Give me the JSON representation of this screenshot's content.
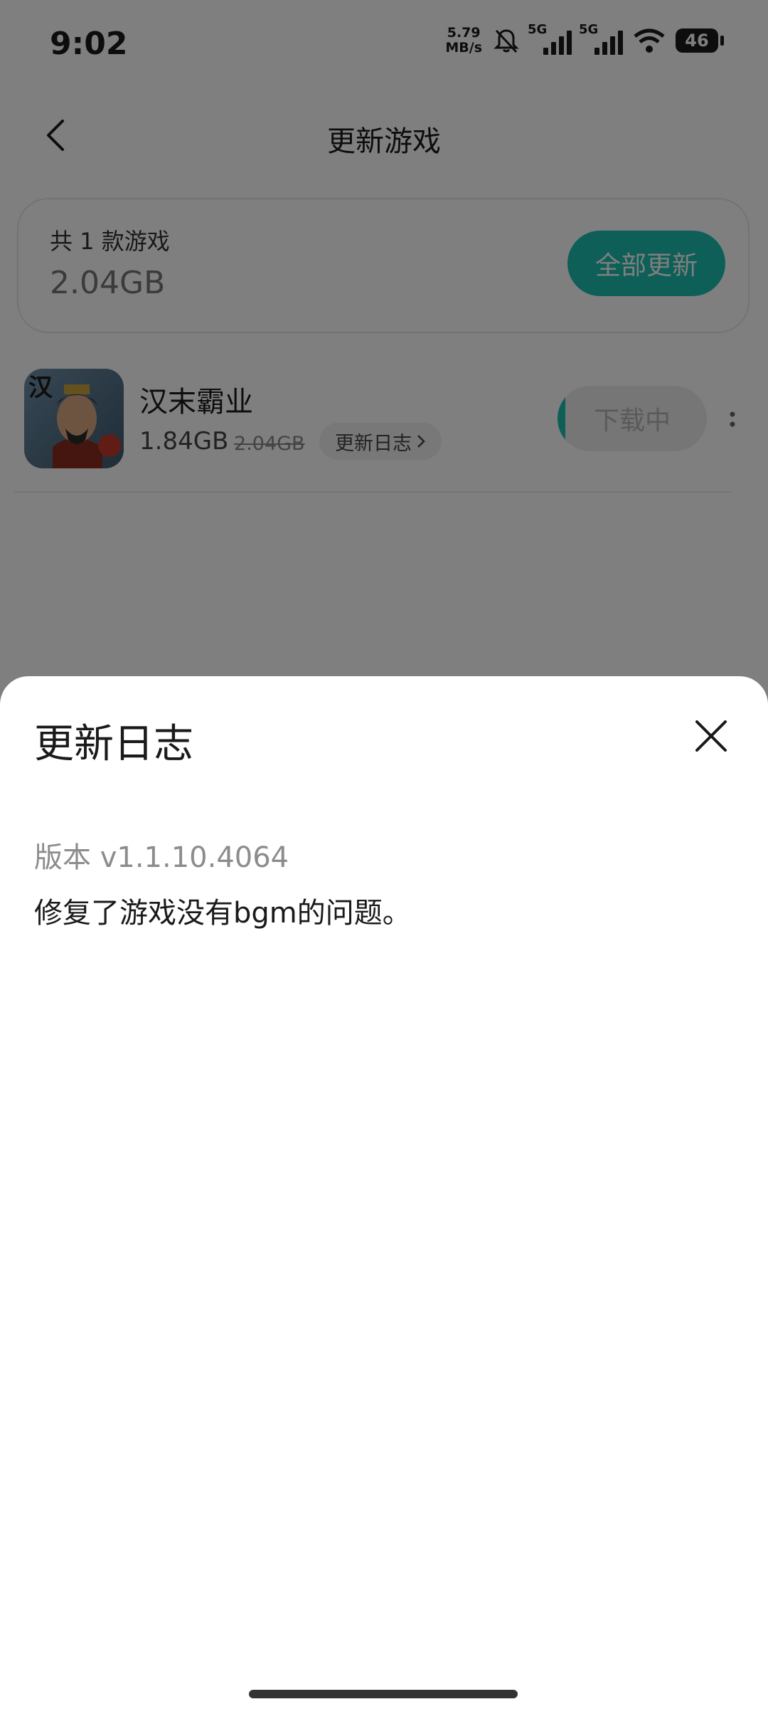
{
  "status_bar": {
    "time": "9:02",
    "net_speed_value": "5.79",
    "net_speed_unit": "MB/s",
    "sim1": "5G",
    "sim2": "5G",
    "battery": "46"
  },
  "header": {
    "title": "更新游戏"
  },
  "summary": {
    "count_text": "共 1 款游戏",
    "total_size": "2.04GB",
    "update_all_label": "全部更新"
  },
  "game": {
    "name": "汉末霸业",
    "download_size": "1.84GB",
    "full_size": "2.04GB",
    "changelog_label": "更新日志",
    "status_label": "下载中",
    "progress_fraction": 0.05
  },
  "sheet": {
    "title": "更新日志",
    "version": "版本 v1.1.10.4064",
    "log": "修复了游戏没有bgm的问题。"
  },
  "colors": {
    "accent": "#1bbfae"
  },
  "icons": [
    "back-arrow-icon",
    "mute-bell-icon",
    "signal-icon",
    "wifi-icon",
    "battery-icon",
    "chevron-right-icon",
    "more-vertical-icon",
    "close-icon"
  ]
}
